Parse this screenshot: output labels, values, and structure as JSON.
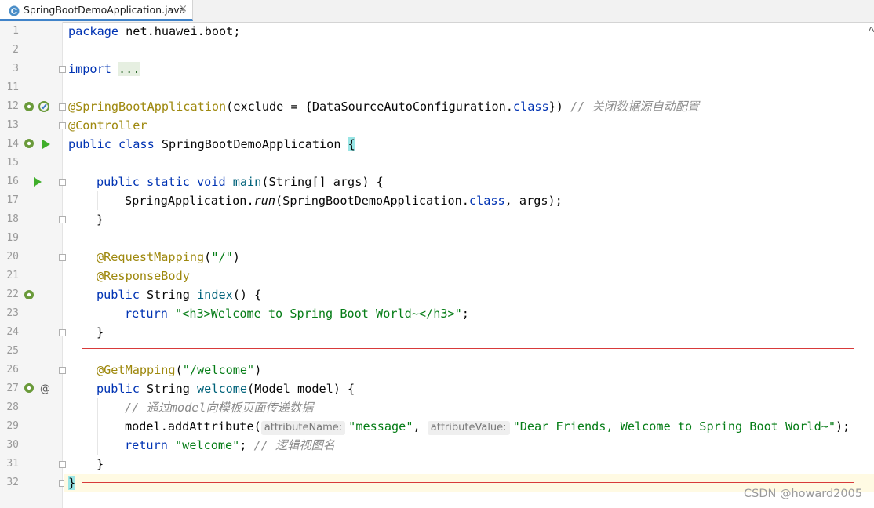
{
  "tab": {
    "title": "SpringBootDemoApplication.java",
    "close_glyph": "×"
  },
  "lines": [
    {
      "n": "1"
    },
    {
      "n": "2"
    },
    {
      "n": "3"
    },
    {
      "n": "11"
    },
    {
      "n": "12"
    },
    {
      "n": "13"
    },
    {
      "n": "14"
    },
    {
      "n": "15"
    },
    {
      "n": "16"
    },
    {
      "n": "17"
    },
    {
      "n": "18"
    },
    {
      "n": "19"
    },
    {
      "n": "20"
    },
    {
      "n": "21"
    },
    {
      "n": "22"
    },
    {
      "n": "23"
    },
    {
      "n": "24"
    },
    {
      "n": "25"
    },
    {
      "n": "26"
    },
    {
      "n": "27"
    },
    {
      "n": "28"
    },
    {
      "n": "29"
    },
    {
      "n": "30"
    },
    {
      "n": "31"
    },
    {
      "n": "32"
    }
  ],
  "code": {
    "l1_kw": "package",
    "l1_rest": " net.huawei.boot;",
    "l3_kw": "import",
    "l3_rest": "...",
    "l12_ann": "@SpringBootApplication",
    "l12_mid": "(exclude = {DataSourceAutoConfiguration.",
    "l12_kw": "class",
    "l12_end": "}) ",
    "l12_cmt": "// 关闭数据源自动配置",
    "l13_ann": "@Controller",
    "l14_kw": "public class",
    "l14_name": " SpringBootDemoApplication ",
    "l14_brace": "{",
    "l16_kw": "public static void",
    "l16_fn": "main",
    "l16_rest": "(String[] args) {",
    "l17_a": "SpringApplication.",
    "l17_fn": "run",
    "l17_b": "(SpringBootDemoApplication.",
    "l17_kw": "class",
    "l17_c": ", args);",
    "l18": "}",
    "l20_ann": "@RequestMapping",
    "l20_p1": "(",
    "l20_str": "\"/\"",
    "l20_p2": ")",
    "l21_ann": "@ResponseBody",
    "l22_kw": "public",
    "l22_type": " String ",
    "l22_fn": "index",
    "l22_rest": "() {",
    "l23_kw": "return",
    "l23_str": "\"<h3>Welcome to Spring Boot World~</h3>\"",
    "l23_end": ";",
    "l24": "}",
    "l26_ann": "@GetMapping",
    "l26_p1": "(",
    "l26_str": "\"/welcome\"",
    "l26_p2": ")",
    "l27_kw": "public",
    "l27_type": " String ",
    "l27_fn": "welcome",
    "l27_rest": "(Model model) {",
    "l28_cmt": "// 通过model向模板页面传递数据",
    "l29_a": "model.addAttribute(",
    "l29_hint1": "attributeName:",
    "l29_str1": "\"message\"",
    "l29_comma": ", ",
    "l29_hint2": "attributeValue:",
    "l29_str2": "\"Dear Friends, Welcome to Spring Boot World~\"",
    "l29_end": ");",
    "l30_kw": "return",
    "l30_str": "\"welcome\"",
    "l30_semi": "; ",
    "l30_cmt": "// 逻辑视图名",
    "l31": "}",
    "l32": "}"
  },
  "watermark": "CSDN @howard2005",
  "icons": {
    "tab": "java-class-icon",
    "spring_bean": "spring-bean-icon",
    "run": "run-gutter-icon",
    "request_mapping": "request-mapping-icon"
  },
  "colors": {
    "keyword": "#0033b3",
    "annotation": "#9e880d",
    "string": "#067d17",
    "comment": "#8c8c8c",
    "highlight_box": "#d83a3a"
  }
}
